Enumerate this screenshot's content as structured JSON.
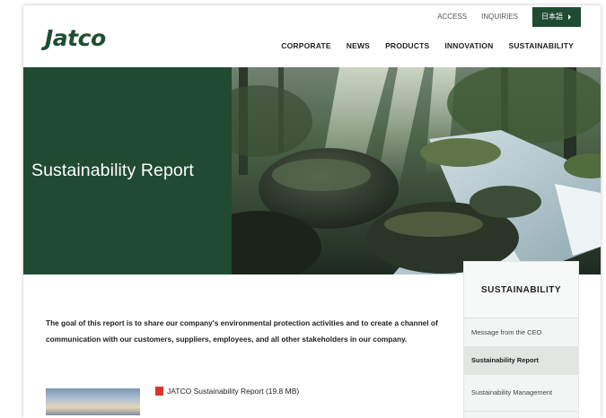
{
  "header": {
    "logo_text": "Jatco",
    "utility_links": [
      "ACCESS",
      "INQUIRIES"
    ],
    "language_button": "日本語",
    "nav": [
      "CORPORATE",
      "NEWS",
      "PRODUCTS",
      "INNOVATION",
      "SUSTAINABILITY"
    ]
  },
  "hero": {
    "title": "Sustainability Report"
  },
  "intro": {
    "text": "The goal of this report is to share our company's environmental protection activities and to create a channel of communication with our customers, suppliers, employees, and all other stakeholders in our company."
  },
  "download": {
    "label": "JATCO Sustainability Report (19.8 MB)",
    "icon": "pdf-icon"
  },
  "sidebar": {
    "title": "SUSTAINABILITY",
    "items": [
      {
        "label": "Message from the CEO",
        "active": false
      },
      {
        "label": "Sustainability Report",
        "active": true
      },
      {
        "label": "Sustainability Management",
        "active": false
      }
    ]
  },
  "colors": {
    "brand_green": "#214a33",
    "pdf_red": "#d9352b"
  }
}
